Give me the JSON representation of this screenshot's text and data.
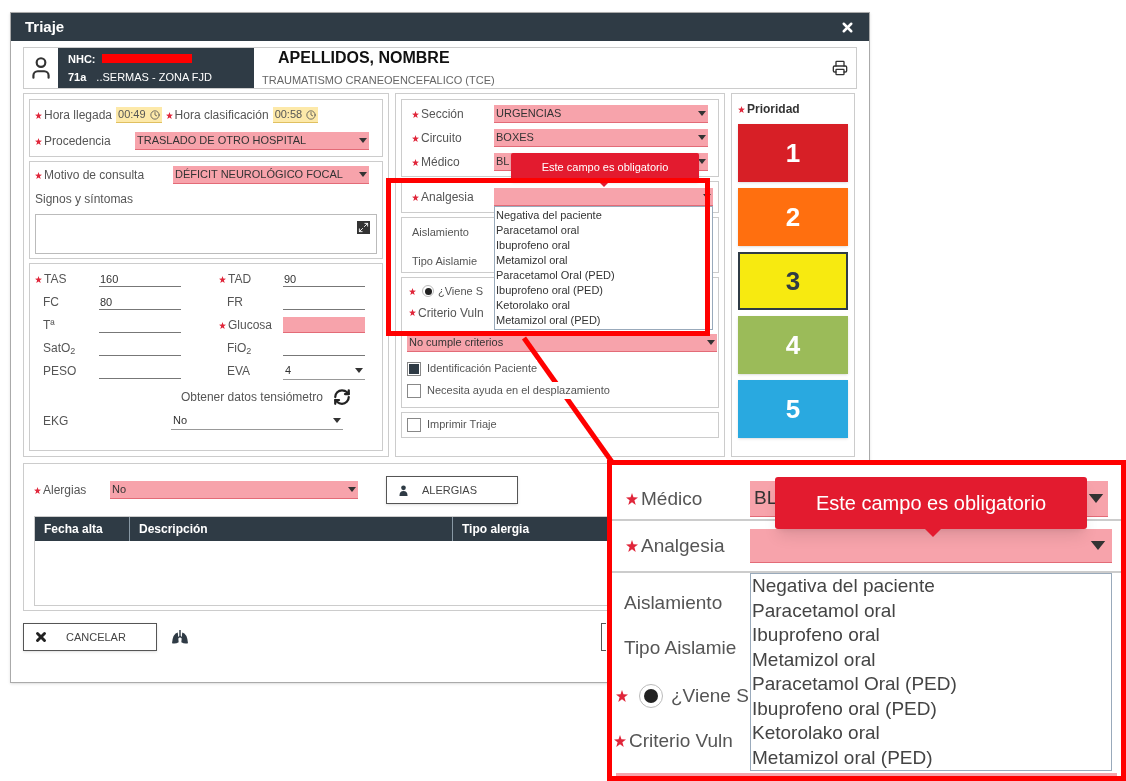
{
  "window": {
    "title": "Triaje"
  },
  "patient": {
    "nhc_label": "NHC:",
    "age": "71a",
    "insurer": "..SERMAS - ZONA FJD",
    "name": "APELLIDOS, NOMBRE",
    "diagnosis": "TRAUMATISMO CRANEOENCEFALICO (TCE)"
  },
  "arrival": {
    "times": [
      {
        "label": "Hora llegada",
        "value": "00:49",
        "required": true
      },
      {
        "label": "Hora clasificación",
        "value": "00:58",
        "required": true
      }
    ],
    "origin": {
      "label": "Procedencia",
      "value": "TRASLADO DE OTRO HOSPITAL",
      "required": true,
      "highlighted": true
    }
  },
  "consultation": {
    "reason": {
      "label": "Motivo de consulta",
      "value": "DÉFICIT NEUROLÓGICO FOCAL",
      "required": true,
      "highlighted": true
    },
    "symptoms_label": "Signos y síntomas"
  },
  "vitals": [
    {
      "label": "TAS",
      "value": "160",
      "required": true,
      "highlighted": false,
      "kind": "text"
    },
    {
      "label": "TAD",
      "value": "90",
      "required": true,
      "highlighted": false,
      "kind": "text"
    },
    {
      "label": "FC",
      "value": "80",
      "required": false,
      "highlighted": false,
      "kind": "text"
    },
    {
      "label": "FR",
      "required": false,
      "highlighted": false,
      "kind": "text"
    },
    {
      "label": "Tª",
      "required": false,
      "highlighted": false,
      "kind": "text"
    },
    {
      "label": "Glucosa",
      "required": true,
      "highlighted": true,
      "kind": "text"
    },
    {
      "label": "SatO$_{2}$",
      "required": false,
      "highlighted": false,
      "kind": "text"
    },
    {
      "label": "FiO$_{2}$",
      "required": false,
      "highlighted": false,
      "kind": "text"
    },
    {
      "label": "PESO",
      "required": false,
      "highlighted": false,
      "kind": "text"
    },
    {
      "label": "EVA",
      "value": "4",
      "required": false,
      "highlighted": false,
      "kind": "select"
    }
  ],
  "tensiometer_button": "Obtener datos tensiómetro",
  "ekg": {
    "label": "EKG",
    "value": "No"
  },
  "assignment": [
    {
      "label": "Sección",
      "value": "URGENCIAS",
      "required": true,
      "highlighted": true
    },
    {
      "label": "Circuito",
      "value": "BOXES",
      "required": true,
      "highlighted": true
    },
    {
      "label": "Médico",
      "value": "BL",
      "required": true,
      "highlighted": true
    }
  ],
  "analgesia": {
    "label": "Analgesia",
    "required": true,
    "highlighted": true,
    "expanded": true,
    "tooltip": "Este campo es obligatorio",
    "options": [
      "Negativa del paciente",
      "Paracetamol oral",
      "Ibuprofeno oral",
      "Metamizol oral",
      "Paracetamol Oral (PED)",
      "Ibuprofeno oral (PED)",
      "Ketorolako oral",
      "Metamizol oral (PED)"
    ]
  },
  "isolation_labels": [
    "Aislamiento",
    "Tipo Aislamie"
  ],
  "vulnerability": {
    "radio": {
      "label": "¿Viene S",
      "selected": true,
      "required": true
    },
    "criterion": {
      "label": "Criterio Vuln",
      "value": "No cumple criterios",
      "required": true,
      "highlighted": true
    }
  },
  "checkboxes": [
    {
      "label": "Identificación Paciente",
      "checked": true
    },
    {
      "label": "Necesita ayuda en el desplazamiento",
      "checked": false
    }
  ],
  "print_option": {
    "label": "Imprimir Triaje",
    "checked": false
  },
  "priority": {
    "label": "Prioridad",
    "required": true,
    "levels": [
      {
        "label": "1",
        "color": "#d71f26",
        "selected": false
      },
      {
        "label": "2",
        "color": "#ff6f0f",
        "selected": false
      },
      {
        "label": "3",
        "color": "#f7ea10",
        "selected": true
      },
      {
        "label": "4",
        "color": "#9bbb59",
        "selected": false
      },
      {
        "label": "5",
        "color": "#29a9e0",
        "selected": false
      }
    ]
  },
  "allergies": {
    "label": "Alergias",
    "value": "No",
    "required": true,
    "highlighted": true,
    "button": "ALERGIAS",
    "columns": [
      "Fecha alta",
      "Descripción",
      "Tipo alergia"
    ]
  },
  "footer": {
    "cancel": "CANCELAR"
  },
  "magnified_inset": {
    "medico": {
      "label": "Médico",
      "value": "BL"
    },
    "tooltip": "Este campo es obligatorio",
    "analgesia_label": "Analgesia",
    "options": [
      "Negativa del paciente",
      "Paracetamol oral",
      "Ibuprofeno oral",
      "Metamizol oral",
      "Paracetamol Oral (PED)",
      "Ibuprofeno oral (PED)",
      "Ketorolako oral",
      "Metamizol oral (PED)"
    ],
    "isolation_labels": [
      "Aislamiento",
      "Tipo Aislamie"
    ],
    "radio": {
      "label": "¿Viene S",
      "selected": true
    },
    "criterion_label": "Criterio Vuln"
  }
}
